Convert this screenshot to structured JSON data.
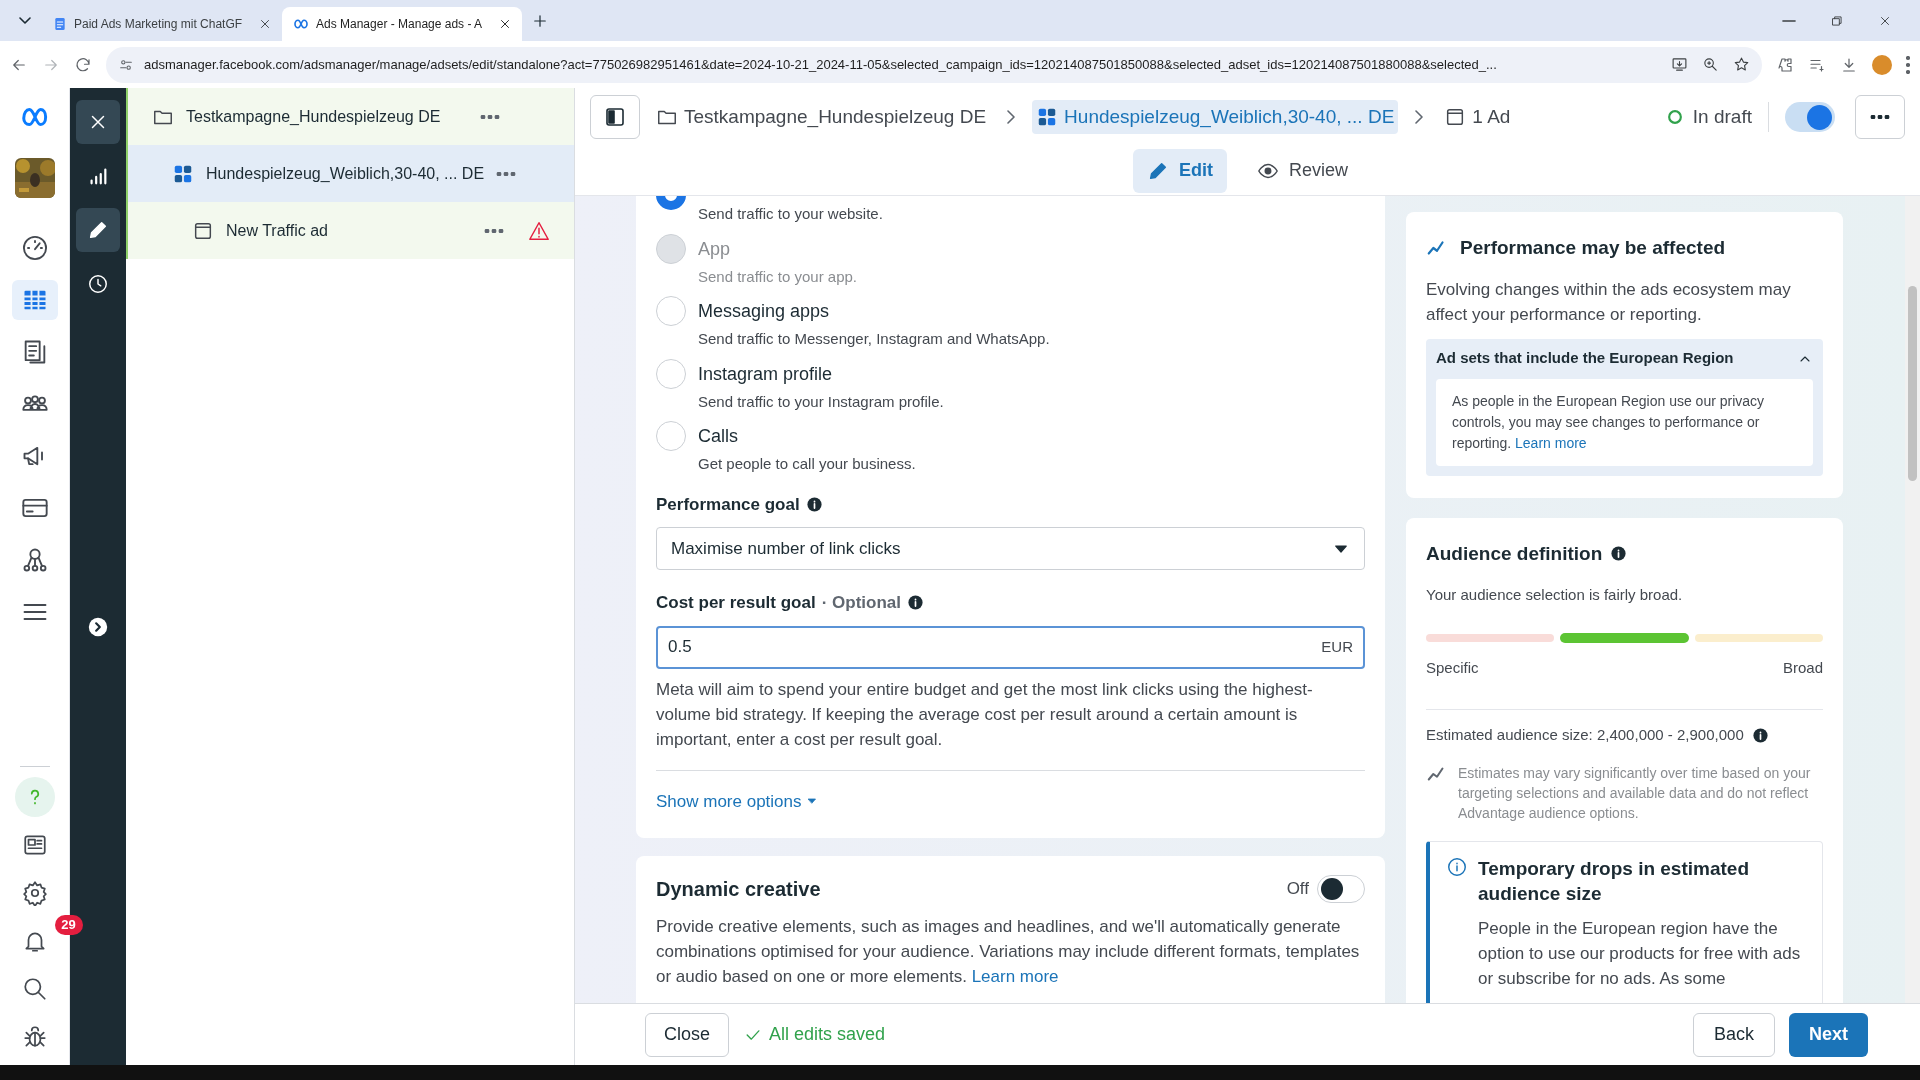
{
  "browser": {
    "tabs": [
      {
        "title": "Paid Ads Marketing mit ChatGF",
        "kind": "doc",
        "selected": false
      },
      {
        "title": "Ads Manager - Manage ads - A",
        "kind": "meta",
        "selected": true
      }
    ],
    "url": "adsmanager.facebook.com/adsmanager/manage/adsets/edit/standalone?act=775026982951461&date=2024-10-21_2024-11-05&selected_campaign_ids=120214087501850088&selected_adset_ids=120214087501880088&selected_..."
  },
  "nav": [
    {
      "kind": "gauge",
      "selected": false
    },
    {
      "kind": "table",
      "selected": true
    },
    {
      "kind": "pages",
      "selected": false
    },
    {
      "kind": "people",
      "selected": false
    },
    {
      "kind": "megaphone",
      "selected": false
    },
    {
      "kind": "card",
      "selected": false
    },
    {
      "kind": "network",
      "selected": false
    },
    {
      "kind": "menu",
      "selected": false
    }
  ],
  "bottom_nav": [
    {
      "kind": "help"
    },
    {
      "kind": "news"
    },
    {
      "kind": "settings"
    },
    {
      "kind": "bell",
      "badge": "29"
    },
    {
      "kind": "search"
    },
    {
      "kind": "bug"
    }
  ],
  "tools": [
    {
      "kind": "close",
      "selected": true
    },
    {
      "kind": "chart",
      "selected": false
    },
    {
      "kind": "edit",
      "selected": true
    },
    {
      "kind": "history",
      "selected": false
    }
  ],
  "tree": [
    {
      "label": "Testkampagne_Hundespielzeug DE",
      "kind": "campaign",
      "selected": false,
      "children": [
        {
          "label": "Hundespielzeug_Weiblich,30-40, ... DE",
          "kind": "adset",
          "selected": true,
          "children": [
            {
              "label": "New Traffic ad",
              "kind": "ad",
              "selected": false,
              "warning": true
            }
          ]
        }
      ]
    }
  ],
  "breadcrumbs": [
    {
      "label": "Testkampagne_Hundespielzeug DE",
      "kind": "campaign",
      "selected": false
    },
    {
      "label": "Hundespielzeug_Weiblich,30-40, ... DE",
      "kind": "adset",
      "selected": true
    },
    {
      "label": "1 Ad",
      "kind": "ad",
      "selected": false
    }
  ],
  "status": {
    "label": "In draft",
    "on": true
  },
  "mode_tabs": [
    {
      "label": "Edit",
      "kind": "edit",
      "selected": true
    },
    {
      "label": "Review",
      "kind": "review",
      "selected": false
    }
  ],
  "destinations": [
    {
      "description": "Send traffic to your website.",
      "selected": true,
      "disabled": false
    },
    {
      "label": "App",
      "description": "Send traffic to your app.",
      "selected": false,
      "disabled": true
    },
    {
      "label": "Messaging apps",
      "description": "Send traffic to Messenger, Instagram and WhatsApp.",
      "selected": false,
      "disabled": false
    },
    {
      "label": "Instagram profile",
      "description": "Send traffic to your Instagram profile.",
      "selected": false,
      "disabled": false
    },
    {
      "label": "Calls",
      "description": "Get people to call your business.",
      "selected": false,
      "disabled": false
    }
  ],
  "performance_goal": {
    "label": "Performance goal",
    "value": "Maximise number of link clicks"
  },
  "cost_goal": {
    "label": "Cost per result goal",
    "optional": "· Optional",
    "value": "0.5",
    "currency": "EUR",
    "help": "Meta will aim to spend your entire budget and get the most link clicks using the highest-volume bid strategy. If keeping the average cost per result around a certain amount is important, enter a cost per result goal."
  },
  "show_more": "Show more options",
  "dynamic_creative": {
    "title": "Dynamic creative",
    "state_label": "Off",
    "on": false,
    "text": "Provide creative elements, such as images and headlines, and we'll automatically generate combinations optimised for your audience. Variations may include different formats, templates or audio based on one or more elements.",
    "link": "Learn more"
  },
  "performance_notice": {
    "title": "Performance may be affected",
    "text": "Evolving changes within the ads ecosystem may affect your performance or reporting.",
    "accordion": {
      "title": "Ad sets that include the European Region",
      "expanded": true,
      "text": "As people in the European Region use our privacy controls, you may see changes to performance or reporting.",
      "link": "Learn more"
    }
  },
  "audience": {
    "title": "Audience definition",
    "text": "Your audience selection is fairly broad.",
    "segments": [
      {
        "color": "#f9dcd9",
        "selected": false
      },
      {
        "color": "#5cc433",
        "selected": true
      },
      {
        "color": "#fbeecd",
        "selected": false
      }
    ],
    "min_label": "Specific",
    "max_label": "Broad",
    "estimate": "Estimated audience size: 2,400,000 - 2,900,000",
    "note": "Estimates may vary significantly over time based on your targeting selections and available data and do not reflect Advantage audience options.",
    "temporary": {
      "title": "Temporary drops in estimated audience size",
      "text": "People in the European region have the option to use our products for free with ads or subscribe for no ads. As some"
    }
  },
  "footer": {
    "close": "Close",
    "saved": "All edits saved",
    "back": "Back",
    "next": "Next"
  }
}
